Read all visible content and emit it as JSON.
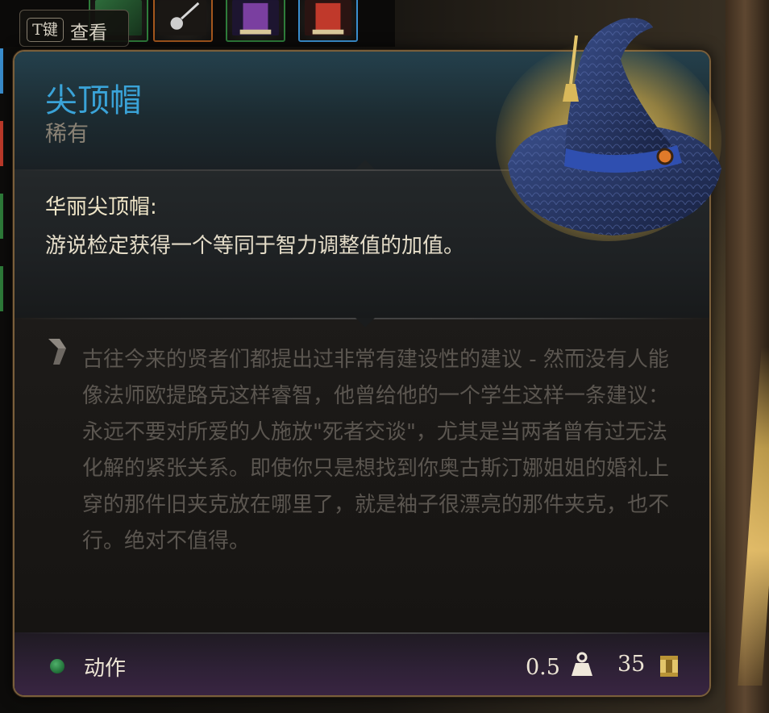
{
  "hotkey": {
    "key": "T键",
    "label": "查看"
  },
  "item": {
    "name": "尖顶帽",
    "rarity": "稀有",
    "icon": "pointed-hat"
  },
  "description": {
    "title": "华丽尖顶帽:",
    "body": "游说检定获得一个等同于智力调整值的加值。"
  },
  "lore": {
    "icon": "quill-icon",
    "text": "古往今来的贤者们都提出过非常有建设性的建议 - 然而没有人能像法师欧提路克这样睿智，他曾给他的一个学生这样一条建议：永远不要对所爱的人施放\"死者交谈\"，尤其是当两者曾有过无法化解的紧张关系。即使你只是想找到你奥古斯汀娜姐姐的婚礼上穿的那件旧夹克放在哪里了，就是袖子很漂亮的那件夹克，也不行。绝对不值得。"
  },
  "footer": {
    "action_label": "动作",
    "action_color": "#2f8a4a",
    "weight": "0.5",
    "weight_icon": "weight-icon",
    "price": "35",
    "price_icon": "gold-coin-icon"
  },
  "colors": {
    "title": "#3aa3d8",
    "rarity": "#8a8275",
    "lore_text": "#5b5650",
    "border": "#7a5f3b"
  }
}
